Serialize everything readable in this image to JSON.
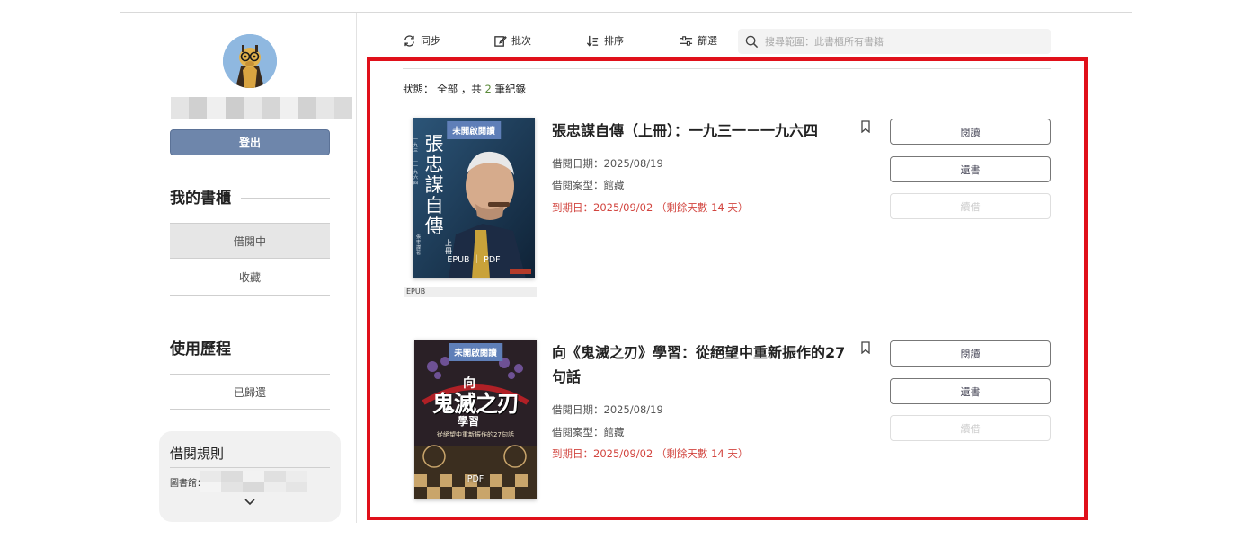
{
  "sidebar": {
    "logout_label": "登出",
    "bookshelf_title": "我的書櫃",
    "bookshelf_items": [
      {
        "label": "借閱中",
        "active": true
      },
      {
        "label": "收藏",
        "active": false
      }
    ],
    "history_title": "使用歷程",
    "history_items": [
      {
        "label": "已歸還"
      }
    ],
    "rules_title": "借閱規則",
    "rules_library_label": "圖書館："
  },
  "toolbar": {
    "sync_label": "同步",
    "batch_label": "批次",
    "sort_label": "排序",
    "filter_label": "篩選",
    "search_placeholder": "搜尋範圍：此書櫃所有書籍"
  },
  "status": {
    "prefix": "狀態：",
    "filter": "全部",
    "sep": "，共",
    "count": "2",
    "suffix": "筆紀錄"
  },
  "books": [
    {
      "title": "張忠謀自傳（上冊）：一九三一－一九六四",
      "cover_badge": "未開啟閱讀",
      "cover_title": "張忠謀自傳",
      "cover_subtitle_small": "一九三一—一九六四",
      "cover_volume": "上冊",
      "cover_author": "張忠謀 著",
      "cover_formats": "EPUB ｜ PDF",
      "format_strip": "EPUB",
      "borrow_date": "借閱日期：2025/08/19",
      "borrow_type": "借閱案型：館藏",
      "due_date": "到期日：2025/09/02 （剩餘天數 14 天）",
      "read_label": "閱讀",
      "return_label": "還書",
      "renew_label": "續借"
    },
    {
      "title": "向《鬼滅之刃》學習：從絕望中重新振作的27句話",
      "cover_badge": "未開啟閱讀",
      "cover_title": "鬼滅之刃",
      "cover_top": "向",
      "cover_bottom": "學習",
      "cover_tagline": "從絕望中重新振作的27句話",
      "cover_formats": "PDF",
      "borrow_date": "借閱日期：2025/08/19",
      "borrow_type": "借閱案型：館藏",
      "due_date": "到期日：2025/09/02 （剩餘天數 14 天）",
      "read_label": "閱讀",
      "return_label": "還書",
      "renew_label": "續借"
    }
  ],
  "colors": {
    "accent": "#6e86ab",
    "highlight": "#e0101a",
    "due": "#d2453f"
  }
}
